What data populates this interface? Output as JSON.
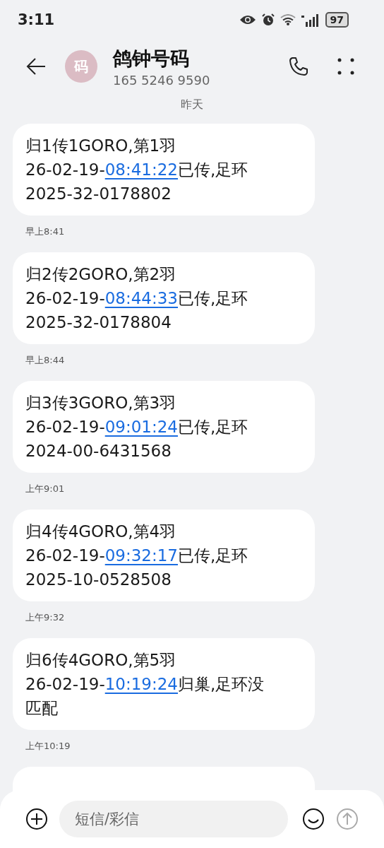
{
  "status_bar": {
    "time": "3:11",
    "battery": "97"
  },
  "header": {
    "avatar": "码",
    "name": "鸽钟号码",
    "number": "165 5246 9590"
  },
  "date_divider": "昨天",
  "messages": [
    {
      "before": "归1传1GORO,第1羽\n26-02-19-",
      "link": "08:41:22",
      "after": "已传,足环\n2025-32-0178802",
      "time": "早上8:41"
    },
    {
      "before": "归2传2GORO,第2羽\n26-02-19-",
      "link": "08:44:33",
      "after": "已传,足环\n2025-32-0178804",
      "time": "早上8:44"
    },
    {
      "before": "归3传3GORO,第3羽\n26-02-19-",
      "link": "09:01:24",
      "after": "已传,足环\n2024-00-6431568",
      "time": "上午9:01"
    },
    {
      "before": "归4传4GORO,第4羽\n26-02-19-",
      "link": "09:32:17",
      "after": "已传,足环\n2025-10-0528508",
      "time": "上午9:32"
    },
    {
      "before": "归6传4GORO,第5羽\n26-02-19-",
      "link": "10:19:24",
      "after": "归巢,足环没匹配",
      "time": "上午10:19"
    }
  ],
  "composer": {
    "placeholder": "短信/彩信"
  }
}
